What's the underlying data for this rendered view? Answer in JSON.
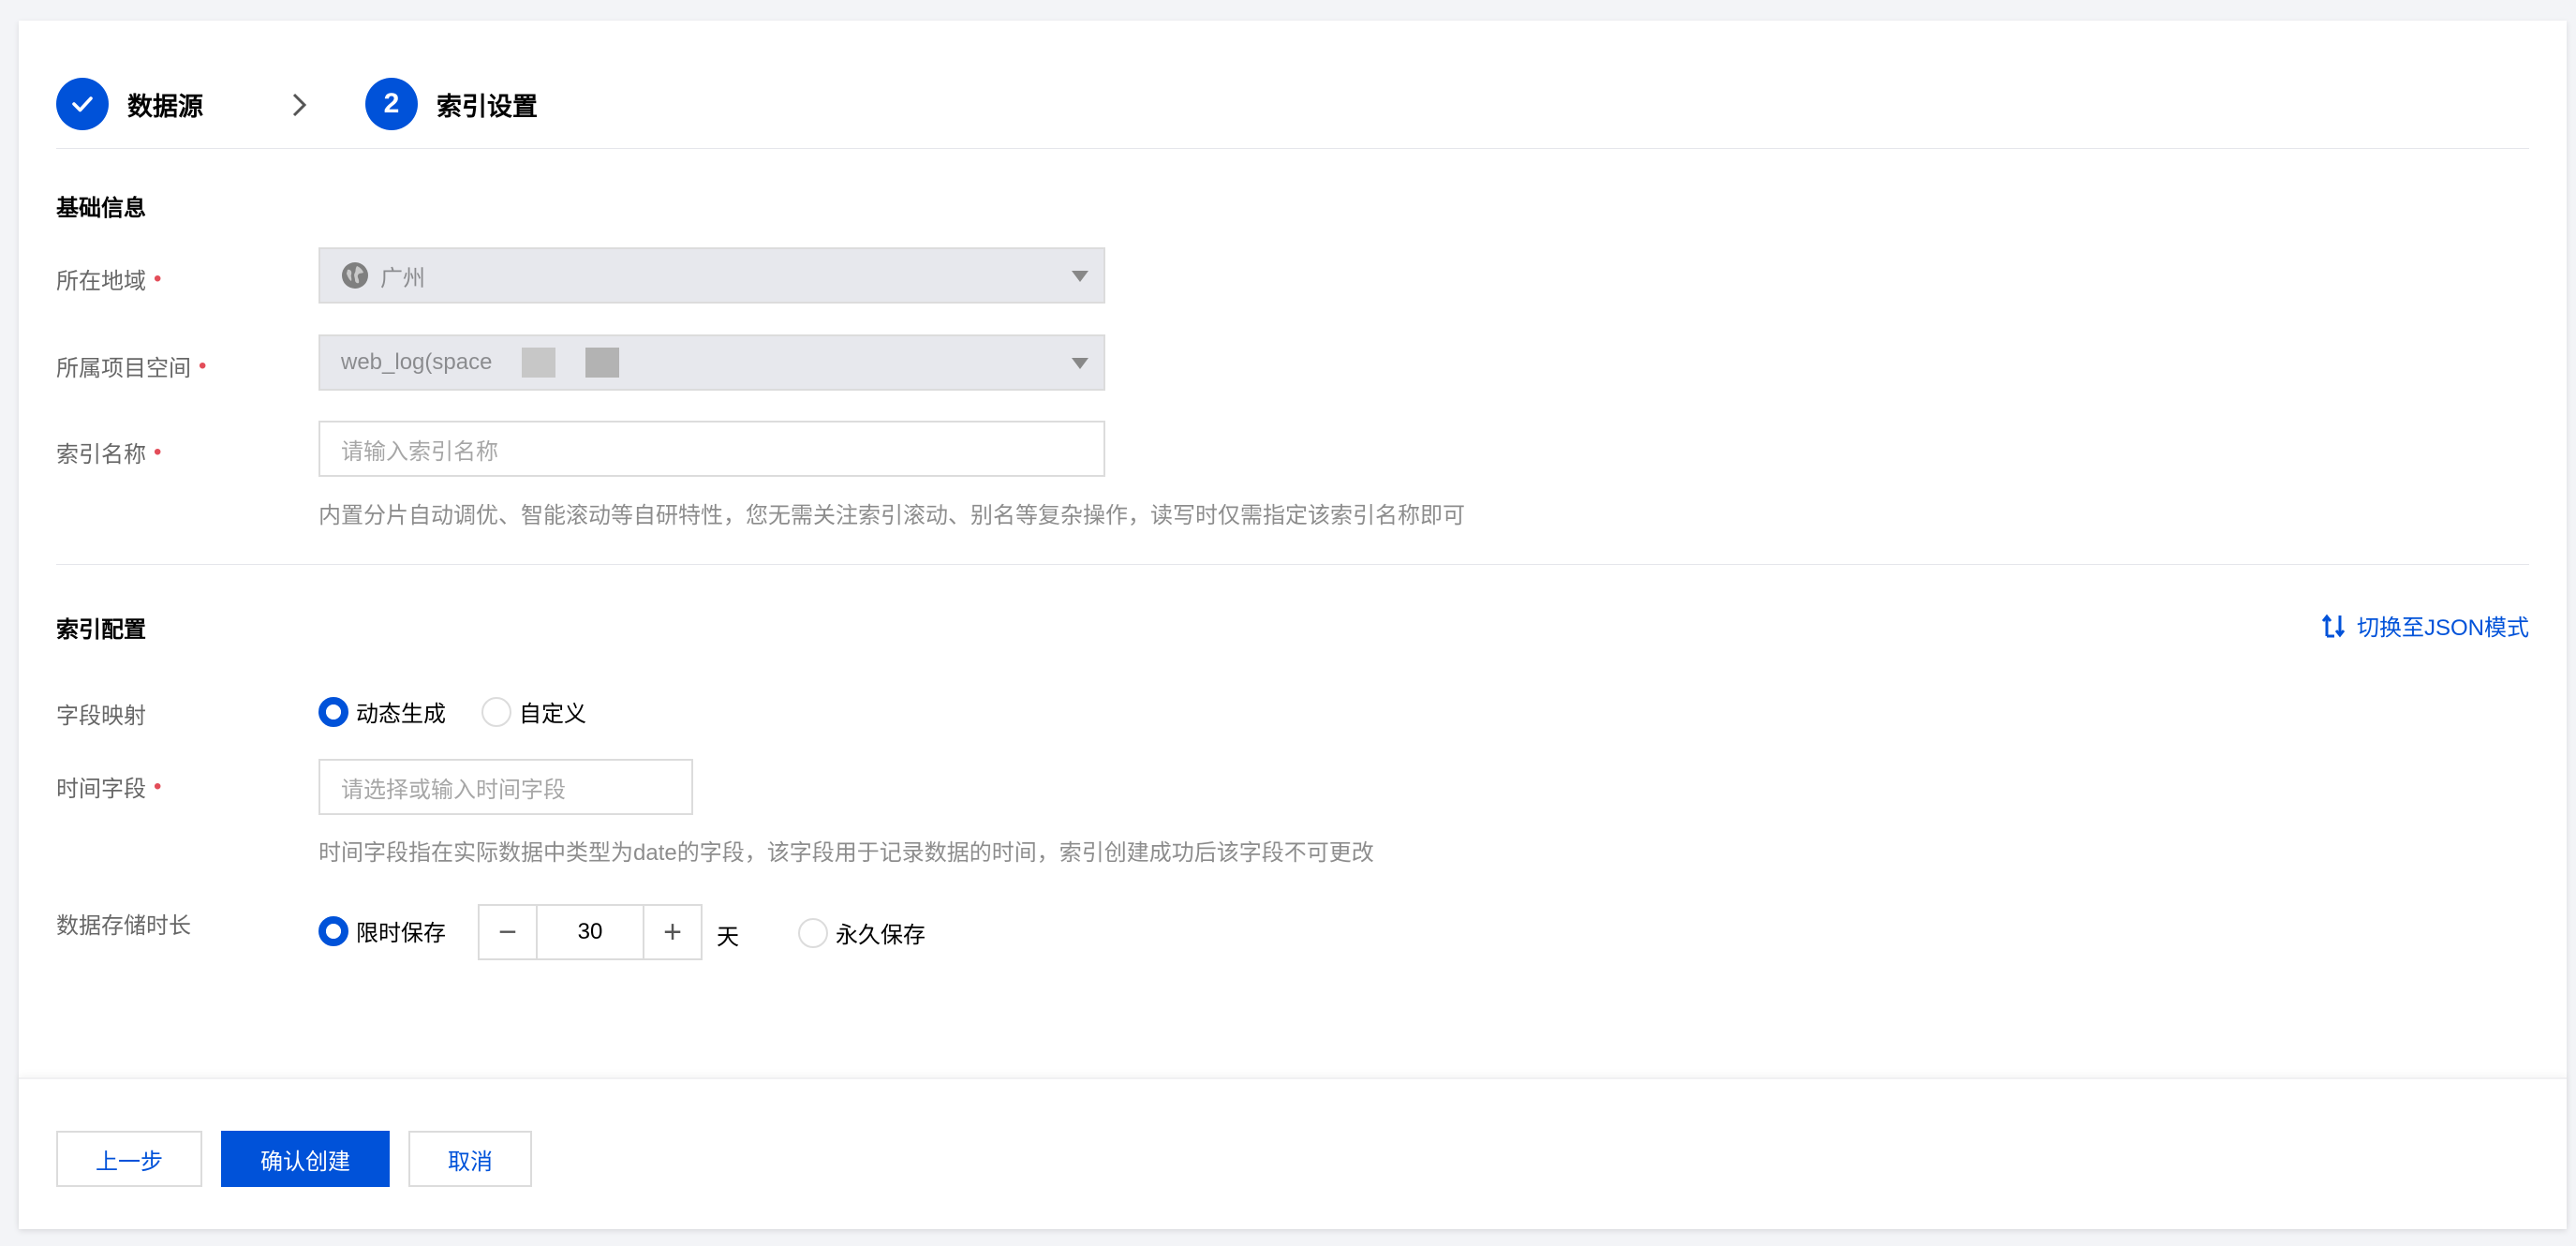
{
  "steps": [
    {
      "label": "数据源",
      "status": "done"
    },
    {
      "label": "索引设置",
      "number": "2",
      "status": "active"
    }
  ],
  "basic": {
    "title": "基础信息",
    "region": {
      "label": "所在地域",
      "value": "广州"
    },
    "project": {
      "label": "所属项目空间",
      "value": "web_log(space"
    },
    "index_name": {
      "label": "索引名称",
      "placeholder": "请输入索引名称",
      "help": "内置分片自动调优、智能滚动等自研特性，您无需关注索引滚动、别名等复杂操作，读写时仅需指定该索引名称即可"
    }
  },
  "config": {
    "title": "索引配置",
    "json_switch": "切换至JSON模式",
    "field_mapping": {
      "label": "字段映射",
      "options": [
        "动态生成",
        "自定义"
      ],
      "selected": 0
    },
    "time_field": {
      "label": "时间字段",
      "placeholder": "请选择或输入时间字段",
      "help": "时间字段指在实际数据中类型为date的字段，该字段用于记录数据的时间，索引创建成功后该字段不可更改"
    },
    "retention": {
      "label": "数据存储时长",
      "limited": "限时保存",
      "value": "30",
      "unit": "天",
      "forever": "永久保存",
      "selected": 0
    }
  },
  "footer": {
    "prev": "上一步",
    "confirm": "确认创建",
    "cancel": "取消"
  },
  "colors": {
    "accent": "#0052d9",
    "required": "#e34d59"
  }
}
